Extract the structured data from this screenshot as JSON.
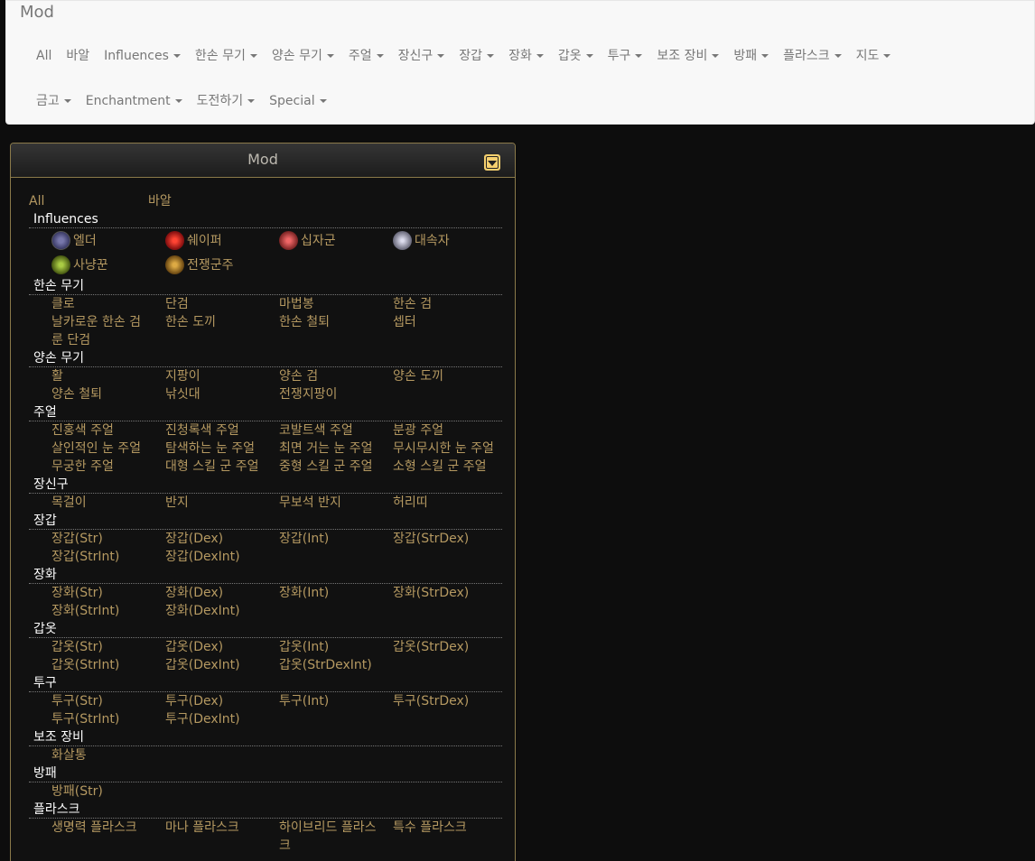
{
  "navbar": {
    "brand": "Mod",
    "row1": [
      {
        "label": "All",
        "dropdown": false
      },
      {
        "label": "바알",
        "dropdown": false
      },
      {
        "label": "Influences",
        "dropdown": true
      },
      {
        "label": "한손 무기",
        "dropdown": true
      },
      {
        "label": "양손 무기",
        "dropdown": true
      },
      {
        "label": "주얼",
        "dropdown": true
      },
      {
        "label": "장신구",
        "dropdown": true
      },
      {
        "label": "장갑",
        "dropdown": true
      },
      {
        "label": "장화",
        "dropdown": true
      },
      {
        "label": "갑옷",
        "dropdown": true
      },
      {
        "label": "투구",
        "dropdown": true
      },
      {
        "label": "보조 장비",
        "dropdown": true
      },
      {
        "label": "방패",
        "dropdown": true
      },
      {
        "label": "플라스크",
        "dropdown": true
      },
      {
        "label": "지도",
        "dropdown": true
      }
    ],
    "row2": [
      {
        "label": "금고",
        "dropdown": true
      },
      {
        "label": "Enchantment",
        "dropdown": true
      },
      {
        "label": "도전하기",
        "dropdown": true
      },
      {
        "label": "Special",
        "dropdown": true
      }
    ]
  },
  "panel": {
    "title": "Mod",
    "top_links": [
      "All",
      "바알"
    ],
    "influences": {
      "title": "Influences",
      "items": [
        {
          "label": "엘더",
          "icon": "elder-icon"
        },
        {
          "label": "쉐이퍼",
          "icon": "shaper-icon"
        },
        {
          "label": "십자군",
          "icon": "crusader-icon"
        },
        {
          "label": "대속자",
          "icon": "redeemer-icon"
        },
        {
          "label": "사냥꾼",
          "icon": "hunter-icon"
        },
        {
          "label": "전쟁군주",
          "icon": "warlord-icon"
        }
      ]
    },
    "categories": [
      {
        "title": "한손 무기",
        "items": [
          "클로",
          "단검",
          "마법봉",
          "한손 검",
          "날카로운 한손 검",
          "한손 도끼",
          "한손 철퇴",
          "셉터",
          "룬 단검"
        ]
      },
      {
        "title": "양손 무기",
        "items": [
          "활",
          "지팡이",
          "양손 검",
          "양손 도끼",
          "양손 철퇴",
          "낚싯대",
          "전쟁지팡이"
        ]
      },
      {
        "title": "주얼",
        "items": [
          "진홍색 주얼",
          "진청록색 주얼",
          "코발트색 주얼",
          "분광 주얼",
          "살인적인 눈 주얼",
          "탐색하는 눈 주얼",
          "최면 거는 눈 주얼",
          "무시무시한 눈 주얼",
          "무궁한 주얼",
          "대형 스킬 군 주얼",
          "중형 스킬 군 주얼",
          "소형 스킬 군 주얼"
        ]
      },
      {
        "title": "장신구",
        "items": [
          "목걸이",
          "반지",
          "무보석 반지",
          "허리띠"
        ]
      },
      {
        "title": "장갑",
        "items": [
          "장갑(Str)",
          "장갑(Dex)",
          "장갑(Int)",
          "장갑(StrDex)",
          "장갑(StrInt)",
          "장갑(DexInt)"
        ]
      },
      {
        "title": "장화",
        "items": [
          "장화(Str)",
          "장화(Dex)",
          "장화(Int)",
          "장화(StrDex)",
          "장화(StrInt)",
          "장화(DexInt)"
        ]
      },
      {
        "title": "갑옷",
        "items": [
          "갑옷(Str)",
          "갑옷(Dex)",
          "갑옷(Int)",
          "갑옷(StrDex)",
          "갑옷(StrInt)",
          "갑옷(DexInt)",
          "갑옷(StrDexInt)"
        ]
      },
      {
        "title": "투구",
        "items": [
          "투구(Str)",
          "투구(Dex)",
          "투구(Int)",
          "투구(StrDex)",
          "투구(StrInt)",
          "투구(DexInt)"
        ]
      },
      {
        "title": "보조 장비",
        "items": [
          "화살통"
        ]
      },
      {
        "title": "방패",
        "items": [
          "방패(Str)"
        ]
      },
      {
        "title": "플라스크",
        "items": [
          "생명력 플라스크",
          "마나 플라스크",
          "하이브리드 플라스크",
          "특수 플라스크"
        ]
      }
    ]
  }
}
